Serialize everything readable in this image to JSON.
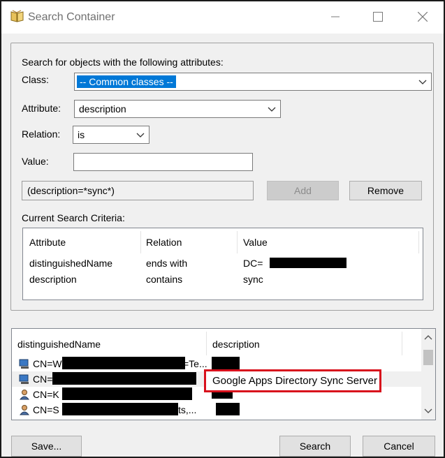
{
  "window": {
    "title": "Search Container"
  },
  "search": {
    "heading": "Search for objects with the following attributes:",
    "class_label": "Class:",
    "class_value": "-- Common classes --",
    "attribute_label": "Attribute:",
    "attribute_value": "description",
    "relation_label": "Relation:",
    "relation_value": "is",
    "value_label": "Value:",
    "value_value": "",
    "filter_text": "(description=*sync*)",
    "add_label": "Add",
    "remove_label": "Remove"
  },
  "criteria": {
    "label": "Current Search Criteria:",
    "columns": [
      "Attribute",
      "Relation",
      "Value"
    ],
    "rows": [
      {
        "attribute": "distinguishedName",
        "relation": "ends with",
        "value": "DC="
      },
      {
        "attribute": "description",
        "relation": "contains",
        "value": "sync"
      }
    ]
  },
  "results": {
    "columns": [
      "distinguishedName",
      "description"
    ],
    "rows": [
      {
        "dn_prefix": "CN=W",
        "dn_suffix": "=Te...",
        "description": ""
      },
      {
        "dn_prefix": "CN=",
        "dn_suffix": "",
        "description": "Google Apps Directory Sync Server"
      },
      {
        "dn_prefix": "CN=K",
        "dn_suffix": "",
        "description": ""
      },
      {
        "dn_prefix": "CN=S",
        "dn_suffix": "ts,...",
        "description": ""
      }
    ]
  },
  "footer": {
    "save_label": "Save...",
    "search_label": "Search",
    "cancel_label": "Cancel"
  }
}
